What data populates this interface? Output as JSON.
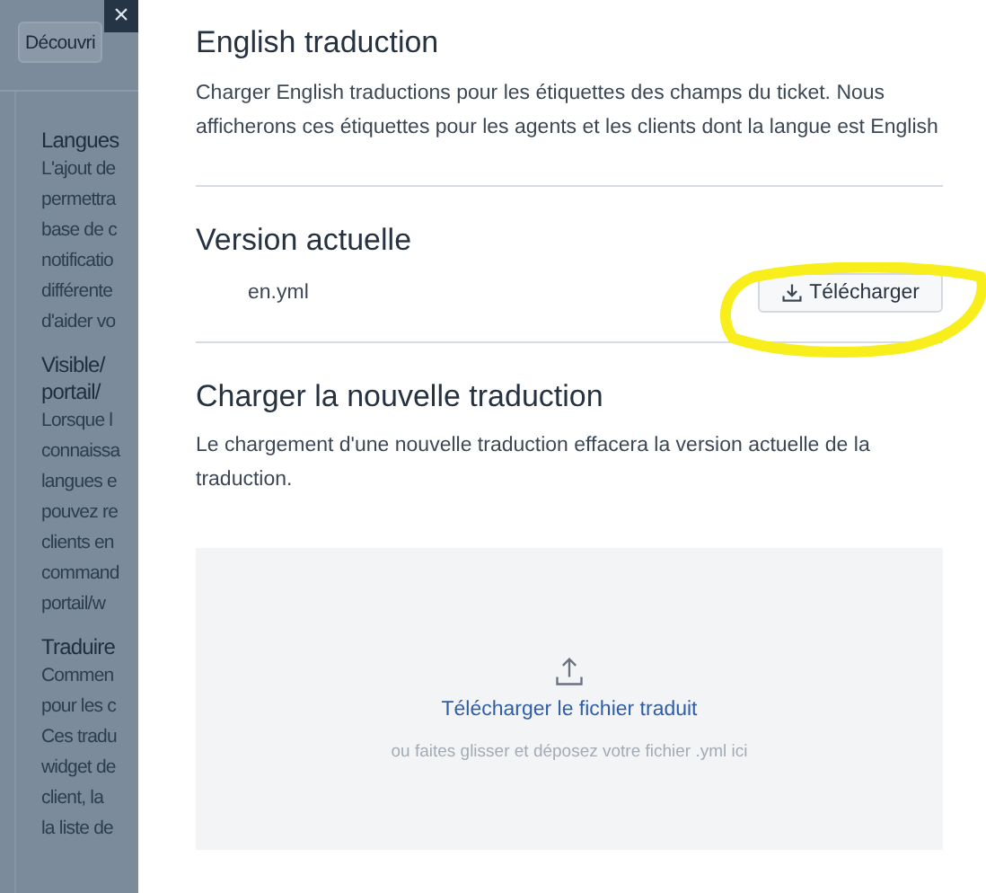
{
  "background": {
    "button": "Découvri",
    "sections": [
      {
        "heading": [
          "Langues"
        ],
        "lines": [
          "L'ajout de",
          "permettra",
          "base de c",
          "notificatio",
          "différente",
          "d'aider vo"
        ]
      },
      {
        "heading": [
          "Visible/",
          "portail/"
        ],
        "lines": [
          "Lorsque l",
          "connaissa",
          "langues e",
          "pouvez re",
          "clients en",
          "command",
          "portail/w"
        ]
      },
      {
        "heading": [
          "Traduire"
        ],
        "lines": [
          "Commen",
          "pour les c",
          "Ces tradu",
          "widget de",
          "client, la",
          "la liste de"
        ]
      }
    ]
  },
  "close_button": "×",
  "drawer": {
    "title": "English traduction",
    "description": "Charger English traductions pour les étiquettes des champs du ticket. Nous afficherons ces étiquettes pour les agents et les clients dont la langue est English",
    "current_version": {
      "heading": "Version actuelle",
      "file": "en.yml",
      "download_button": "Télécharger"
    },
    "upload": {
      "heading": "Charger la nouvelle traduction",
      "description": "Le chargement d'une nouvelle traduction effacera la version actuelle de la traduction.",
      "dropzone": {
        "link": "Télécharger le fichier traduit",
        "hint": "ou faites glisser et déposez votre fichier .yml ici"
      }
    }
  }
}
